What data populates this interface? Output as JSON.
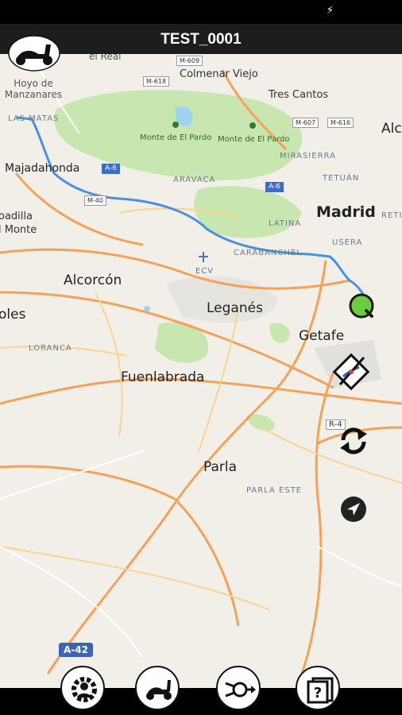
{
  "status": {
    "icon": "flash-icon"
  },
  "header": {
    "title": "TEST_0001",
    "logo": "scooter-logo-icon"
  },
  "map": {
    "places": {
      "el_real": "el Real",
      "colmenar_viejo": "Colmenar Viejo",
      "hoyo": "Hoyo de\nManzanares",
      "tres_cantos": "Tres Cantos",
      "las_matas": "LAS MATAS",
      "alco": "Alco",
      "monte1": "Monte de El Pardo",
      "monte2": "Monte de El Pardo",
      "mirasierra": "MIRASIERRA",
      "majadahonda": "Majadahonda",
      "tetuan": "TETUÁN",
      "aravaca": "ARAVACA",
      "boadilla": "oadilla\nl Monte",
      "madrid": "Madrid",
      "retiro": "RETI",
      "latina": "LATINA",
      "usera": "USERA",
      "carabanchel": "CARABANCHEL",
      "ecv": "ECV",
      "alcorcon": "Alcorcón",
      "moles": "oles",
      "leganes": "Leganés",
      "getafe": "Getafe",
      "loranca": "LORANCA",
      "fuenlabrada": "Fuenlabrada",
      "parla": "Parla",
      "parla_este": "PARLA ESTE"
    },
    "roads": {
      "m609": "M-609",
      "m618": "M-618",
      "m607": "M-607",
      "m616": "M-616",
      "a6a": "A-6",
      "a6b": "A-6",
      "m40": "M-40",
      "r4": "R-4",
      "a42": "A-42"
    },
    "colors": {
      "route": "#4a90e2",
      "highway": "#f4a15a",
      "water": "#9fd3f0",
      "park": "#c8e6b0",
      "land": "#f2efe9"
    }
  },
  "controls": {
    "destination_marker": "destination-q-icon",
    "no_route_toggle": "route-off-icon",
    "refresh": "refresh-icon",
    "locate": "navigation-arrow-icon"
  },
  "bottom_nav": [
    {
      "name": "settings-icon"
    },
    {
      "name": "scooter-icon"
    },
    {
      "name": "tools-icon"
    },
    {
      "name": "help-icon"
    }
  ]
}
